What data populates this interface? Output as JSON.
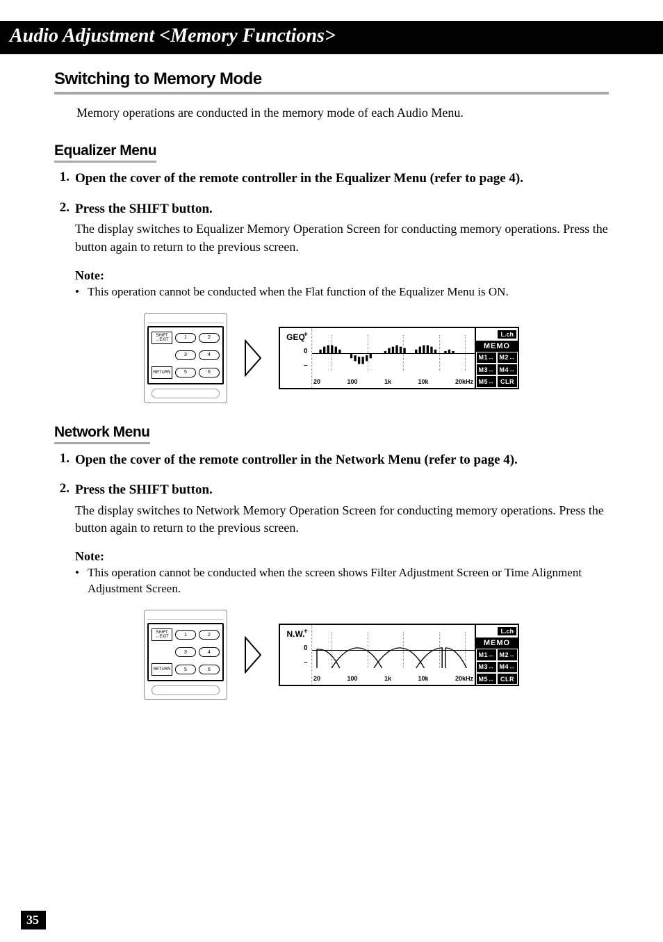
{
  "banner": "Audio Adjustment <Memory Functions>",
  "h1": "Switching to Memory Mode",
  "intro": "Memory operations are conducted in the memory mode of each Audio Menu.",
  "eq": {
    "heading": "Equalizer Menu",
    "step1_num": "1.",
    "step1_title": "Open the cover of the remote controller in the Equalizer Menu (refer to page 4).",
    "step2_num": "2.",
    "step2_title": "Press the SHIFT button.",
    "step2_desc": "The display switches to Equalizer Memory Operation Screen for conducting memory operations. Press the button again to return to the previous screen.",
    "note_label": "Note:",
    "note_text": "This operation cannot be conducted when the Flat function of the Equalizer Menu is ON."
  },
  "nw": {
    "heading": "Network Menu",
    "step1_num": "1.",
    "step1_title": "Open the cover of the remote controller in the Network Menu (refer to page 4).",
    "step2_num": "2.",
    "step2_title": "Press the SHIFT button.",
    "step2_desc": "The display switches to Network Memory Operation Screen for conducting memory operations. Press the button again to return to the previous screen.",
    "note_label": "Note:",
    "note_text": "This operation cannot be conducted when the screen shows Filter Adjustment Screen or Time Alignment Adjustment Screen."
  },
  "remote": {
    "shift": "SHIFT\n↔EXIT",
    "return": "RETURN",
    "b1": "1",
    "b2": "2",
    "b3": "3",
    "b4": "4",
    "b5": "5",
    "b6": "6"
  },
  "lcd": {
    "geq_title": "GEQ",
    "nw_title": "N.W.",
    "plus": "+",
    "zero": "0",
    "minus": "–",
    "lch": "L.ch",
    "memo": "MEMO",
    "x": {
      "a": "20",
      "b": "100",
      "c": "1k",
      "d": "10k",
      "e": "20kHz"
    },
    "mem": {
      "m1": "M1↔",
      "m2": "M2↔",
      "m3": "M3↔",
      "m4": "M4↔",
      "m5": "M5↔",
      "clr": "CLR"
    }
  },
  "page_number": "35",
  "bullet": "•"
}
